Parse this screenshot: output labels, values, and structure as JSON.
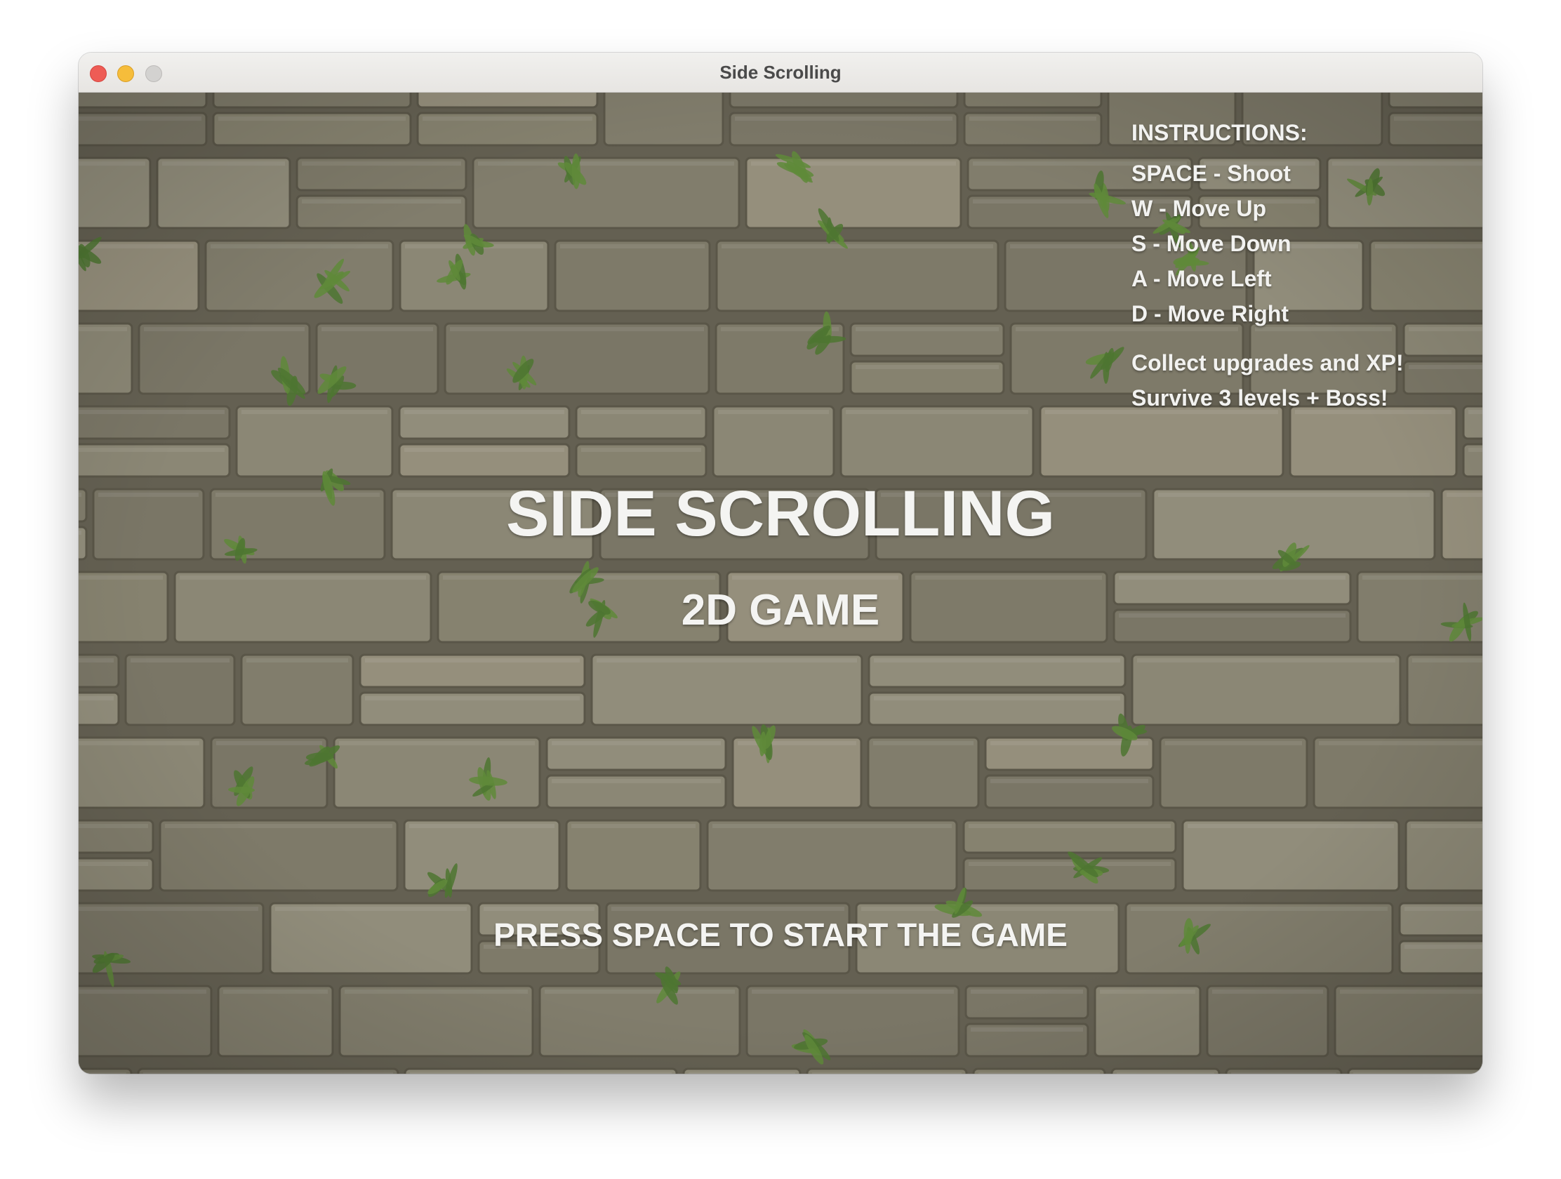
{
  "window": {
    "title": "Side Scrolling"
  },
  "instructions": {
    "heading": "INSTRUCTIONS:",
    "controls": [
      "SPACE - Shoot",
      "W - Move Up",
      "S - Move Down",
      "A - Move Left",
      "D - Move Right"
    ],
    "notes": [
      "Collect upgrades and XP!",
      "Survive 3 levels + Boss!"
    ]
  },
  "game": {
    "title": "SIDE SCROLLING",
    "subtitle": "2D GAME",
    "start_prompt": "PRESS SPACE TO START THE GAME"
  },
  "colors": {
    "stone": "#8a8674",
    "mortar": "#5f5b4c",
    "moss": "#5f8a3a",
    "text": "#f4f4f2"
  }
}
